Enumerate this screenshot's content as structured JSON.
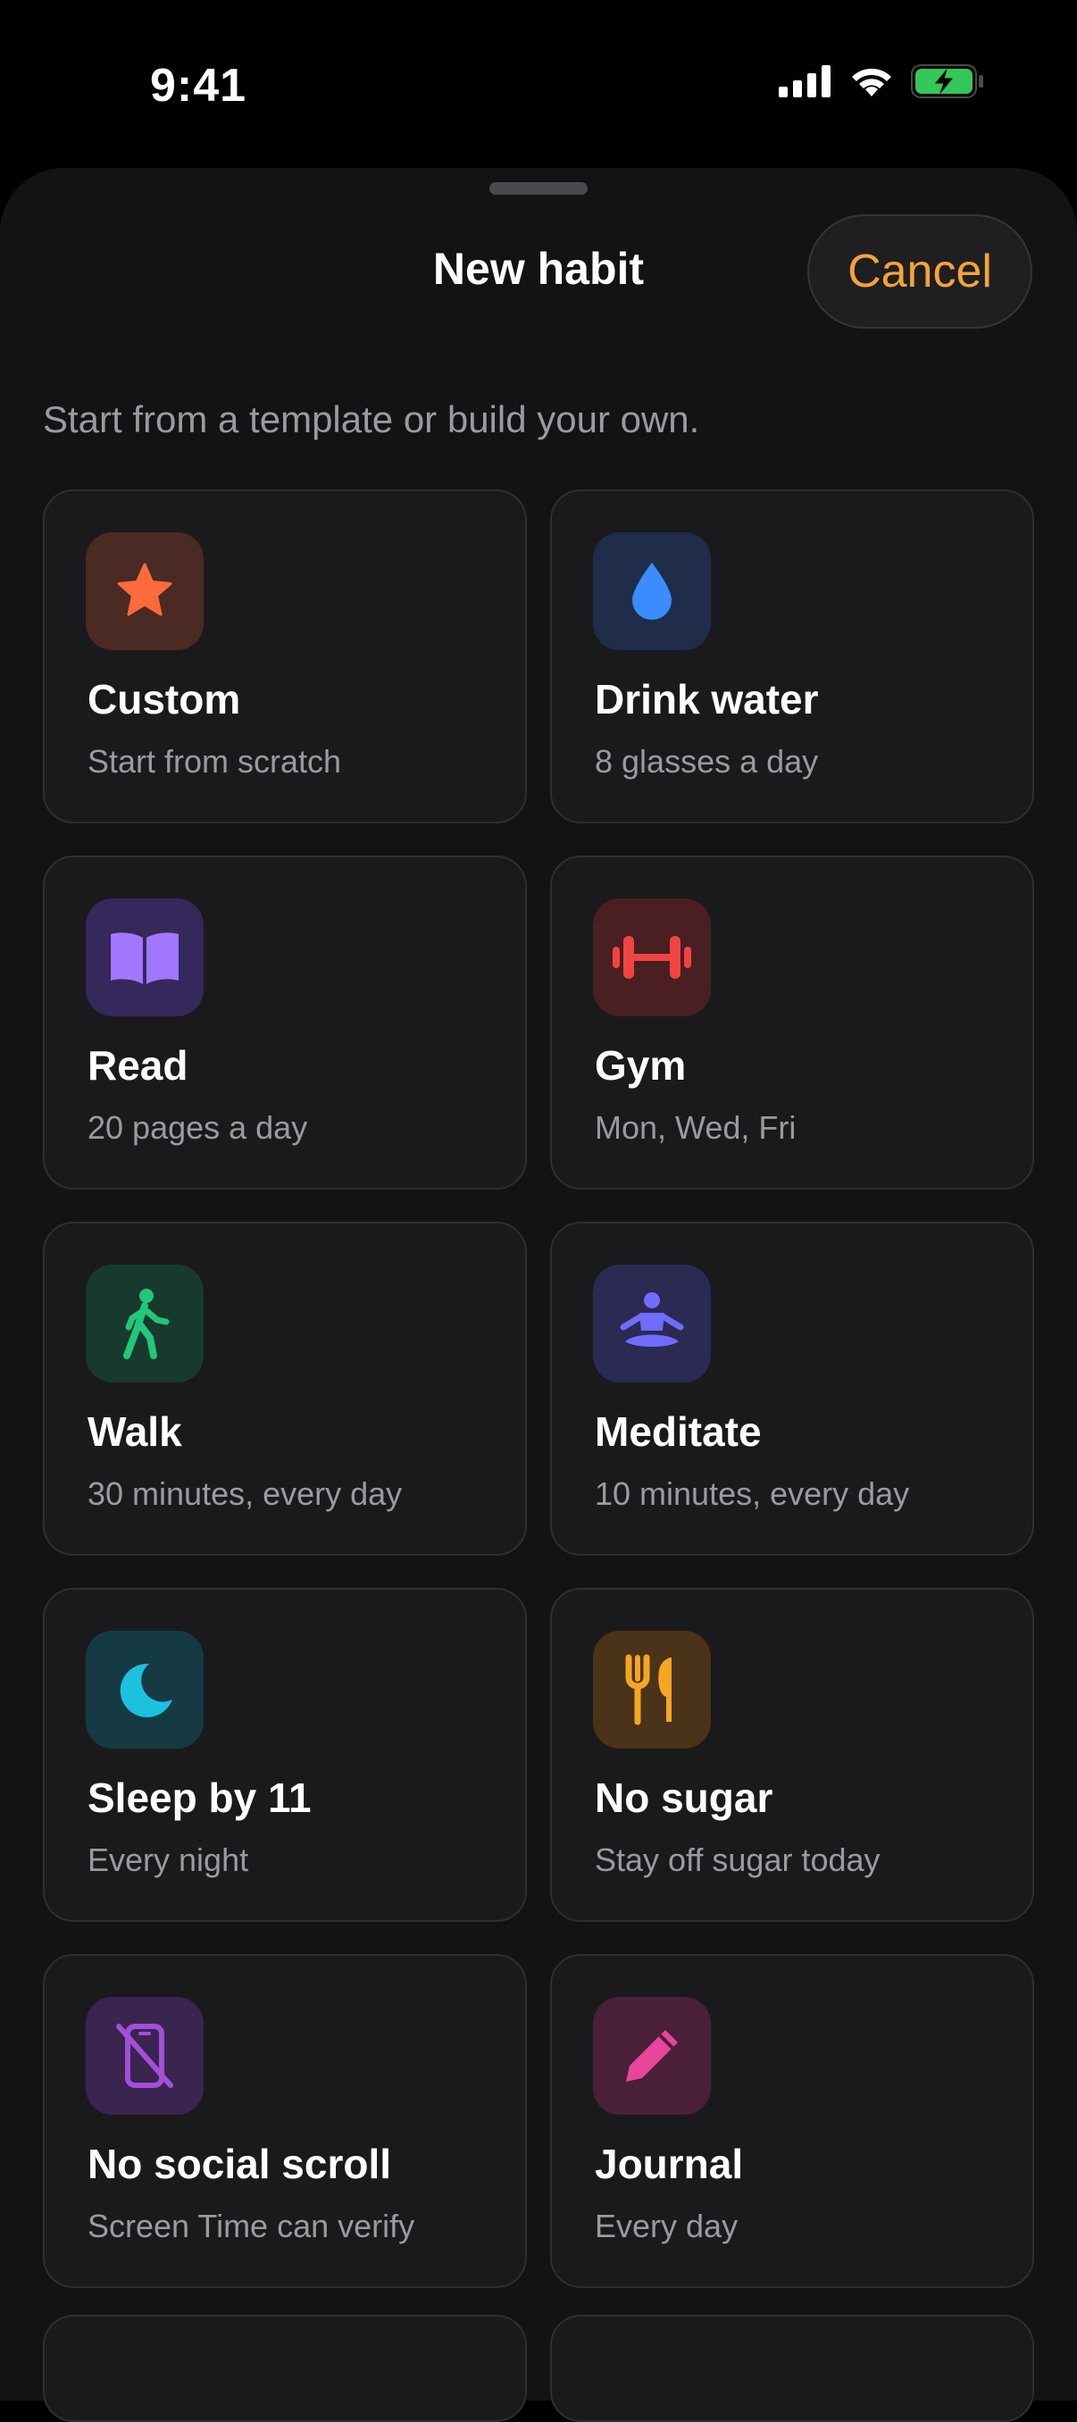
{
  "status_bar": {
    "time": "9:41"
  },
  "sheet": {
    "title": "New habit",
    "cancel_label": "Cancel",
    "subtitle": "Start from a template or build your own."
  },
  "colors": {
    "accent": "#f5a33b",
    "sheet_background": "#131315",
    "card_background": "#1a1a1d",
    "secondary_text": "#9a9aa0"
  },
  "templates": [
    {
      "title": "Custom",
      "subtitle": "Start from scratch",
      "icon": "star-icon",
      "icon_color": "#ff6a3d",
      "icon_bg": "#4a2a22"
    },
    {
      "title": "Drink water",
      "subtitle": "8 glasses a day",
      "icon": "water-drop-icon",
      "icon_color": "#3b8cff",
      "icon_bg": "#1f2d4a"
    },
    {
      "title": "Read",
      "subtitle": "20 pages a day",
      "icon": "book-icon",
      "icon_color": "#a277ff",
      "icon_bg": "#35285a"
    },
    {
      "title": "Gym",
      "subtitle": "Mon, Wed, Fri",
      "icon": "dumbbell-icon",
      "icon_color": "#f04444",
      "icon_bg": "#4a1f22"
    },
    {
      "title": "Walk",
      "subtitle": "30 minutes, every day",
      "icon": "walking-icon",
      "icon_color": "#22c77a",
      "icon_bg": "#183a2e"
    },
    {
      "title": "Meditate",
      "subtitle": "10 minutes, every day",
      "icon": "meditation-icon",
      "icon_color": "#6f6cff",
      "icon_bg": "#2a2a52"
    },
    {
      "title": "Sleep by 11",
      "subtitle": "Every night",
      "icon": "moon-icon",
      "icon_color": "#1cc1e0",
      "icon_bg": "#163a44"
    },
    {
      "title": "No sugar",
      "subtitle": "Stay off sugar today",
      "icon": "fork-knife-icon",
      "icon_color": "#f5a623",
      "icon_bg": "#4a3318"
    },
    {
      "title": "No social scroll",
      "subtitle": "Screen Time can verify",
      "icon": "phone-slash-icon",
      "icon_color": "#a24fd9",
      "icon_bg": "#3a2450"
    },
    {
      "title": "Journal",
      "subtitle": "Every day",
      "icon": "pencil-icon",
      "icon_color": "#e8449a",
      "icon_bg": "#4a2038"
    }
  ]
}
